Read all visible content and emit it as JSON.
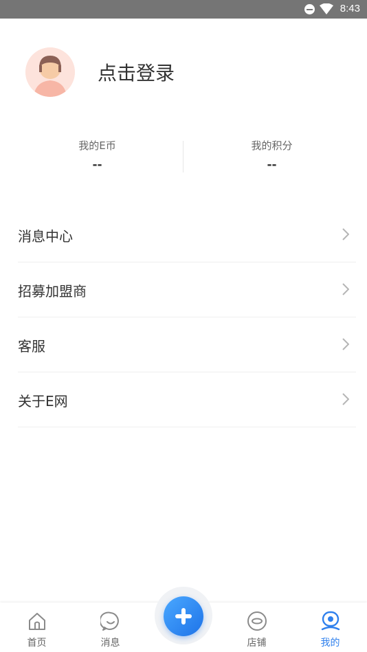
{
  "status_bar": {
    "time": "8:43"
  },
  "profile": {
    "login_label": "点击登录"
  },
  "stats": [
    {
      "label": "我的E币",
      "value": "--"
    },
    {
      "label": "我的积分",
      "value": "--"
    }
  ],
  "menu": [
    {
      "label": "消息中心"
    },
    {
      "label": "招募加盟商"
    },
    {
      "label": "客服"
    },
    {
      "label": "关于E网"
    }
  ],
  "tabbar": {
    "tabs": [
      {
        "label": "首页",
        "icon": "home-icon"
      },
      {
        "label": "消息",
        "icon": "message-icon"
      },
      {
        "label": "店铺",
        "icon": "shop-icon"
      },
      {
        "label": "我的",
        "icon": "profile-icon",
        "active": true
      }
    ],
    "fab_icon": "plus-icon"
  },
  "colors": {
    "accent": "#2f80ed",
    "status_bar": "#757575"
  }
}
